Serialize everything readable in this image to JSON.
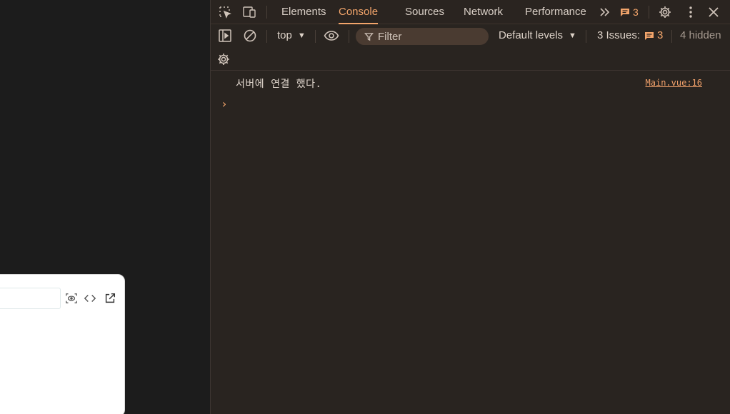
{
  "devtools": {
    "tabs": [
      {
        "label": "Elements",
        "active": false
      },
      {
        "label": "Console",
        "active": true
      },
      {
        "label": "Sources",
        "active": false
      },
      {
        "label": "Network",
        "active": false
      },
      {
        "label": "Performance",
        "active": false
      }
    ],
    "messages_badge": "3",
    "toolbar": {
      "context": "top",
      "filter_placeholder": "Filter",
      "levels": "Default levels",
      "issues_label": "3 Issues:",
      "issues_count": "3",
      "hidden": "4 hidden"
    },
    "console": {
      "message": "서버에 연결 했다.",
      "source": "Main.vue:16",
      "prompt": "›"
    }
  },
  "colors": {
    "accent": "#f3a56b",
    "panel_bg": "#292420",
    "page_bg": "#1c1c1c"
  }
}
